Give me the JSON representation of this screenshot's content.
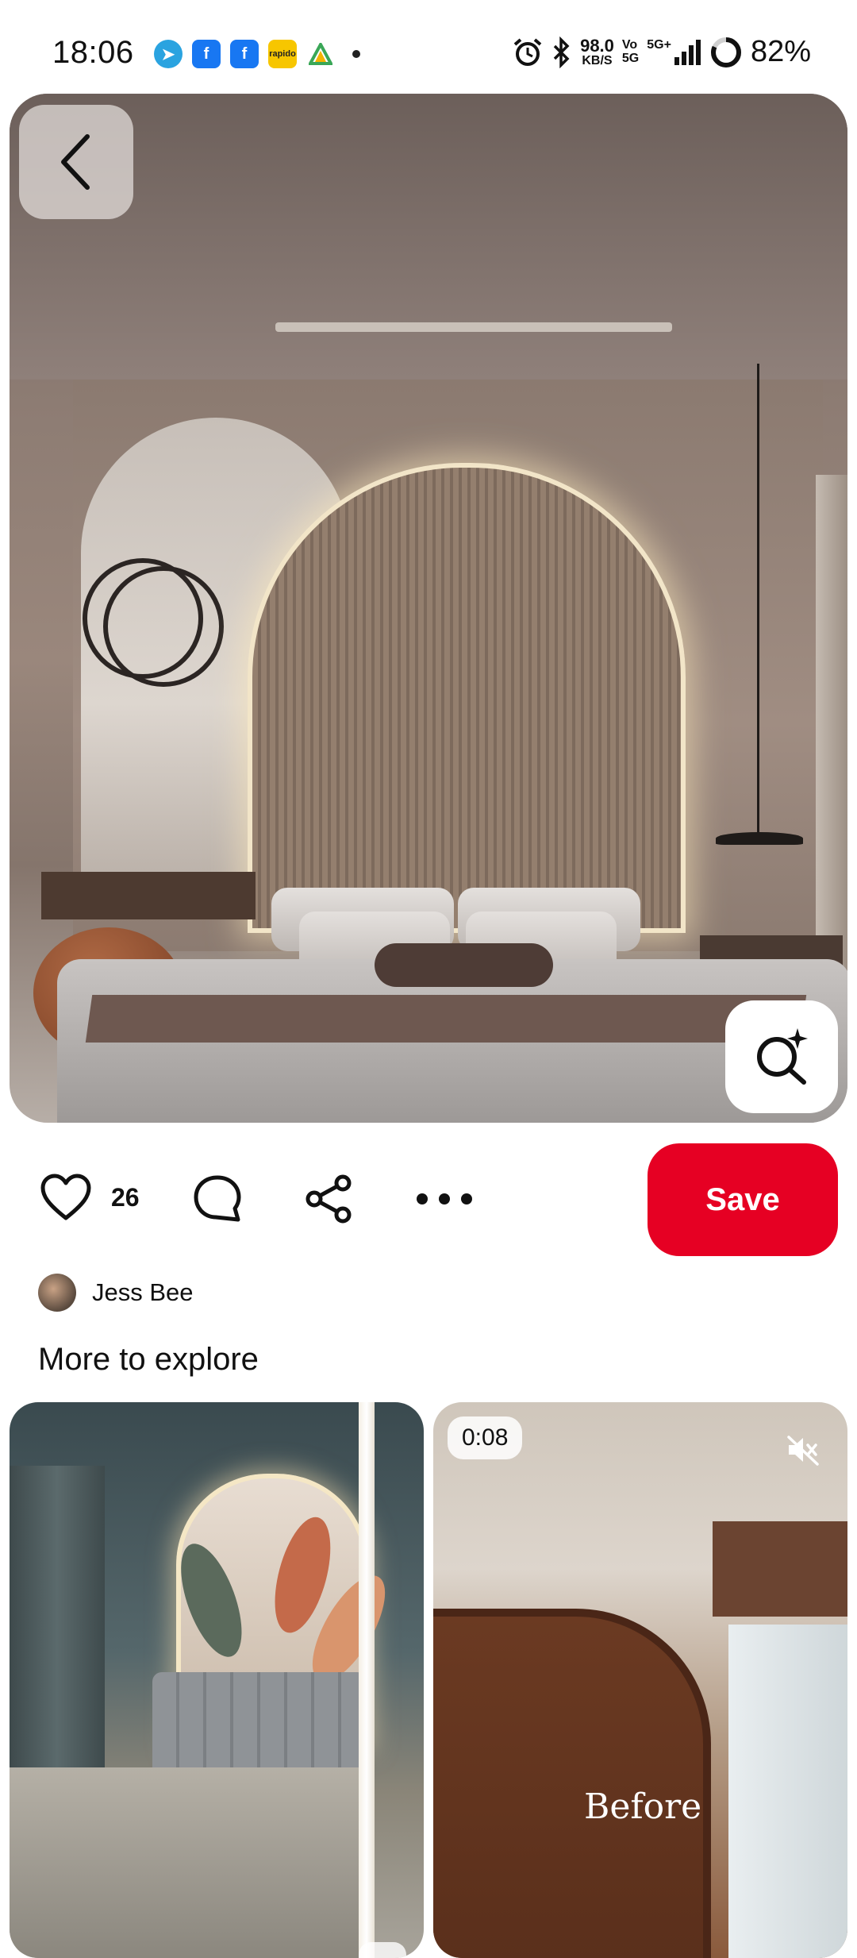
{
  "status_bar": {
    "time": "18:06",
    "net_speed_value": "98.0",
    "net_speed_unit": "KB/S",
    "volte_top": "Vo",
    "volte_bottom": "5G",
    "signal_label": "5G+",
    "battery": "82%",
    "notification_icons": [
      "telegram-icon",
      "facebook-icon",
      "facebook-icon",
      "rapido-icon",
      "triangle-app-icon"
    ],
    "rapido_label": "rapido"
  },
  "pin": {
    "back_icon": "chevron-left-icon",
    "visual_search_icon": "sparkle-search-icon",
    "like_count": "26",
    "save_label": "Save",
    "author_name": "Jess Bee"
  },
  "explore": {
    "title": "More to explore",
    "cards": [
      {
        "type": "image"
      },
      {
        "type": "video",
        "duration": "0:08",
        "overlay_text": "Before",
        "muted": true
      }
    ]
  },
  "colors": {
    "save_red": "#e60023",
    "text": "#111111",
    "background": "#ffffff"
  }
}
